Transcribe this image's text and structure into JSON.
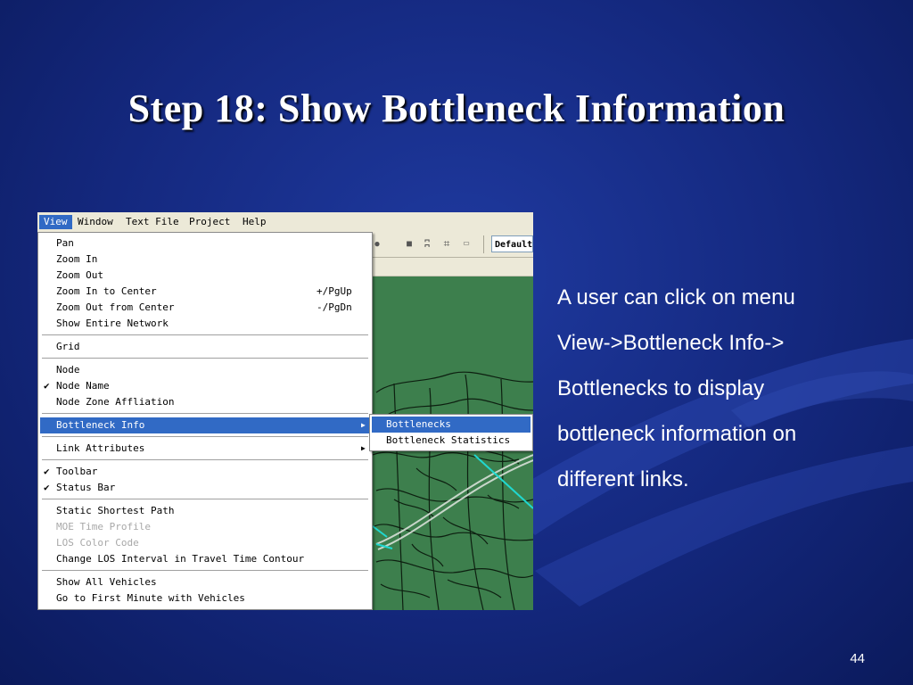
{
  "slide": {
    "title": "Step 18: Show Bottleneck Information",
    "body_lines": [
      "A user can click on menu",
      "View->Bottleneck Info->",
      "Bottlenecks to display",
      "bottleneck information on",
      "different links."
    ],
    "page_number": "44"
  },
  "app": {
    "menubar": [
      "View",
      "Window",
      "Text File",
      "Project",
      "Help"
    ],
    "toolbar": {
      "combo_value": "Default"
    },
    "view_menu": {
      "items": [
        {
          "label": "Pan",
          "shortcut": "",
          "checked": false,
          "disabled": false,
          "submenu": false
        },
        {
          "label": "Zoom In",
          "shortcut": "",
          "checked": false,
          "disabled": false,
          "submenu": false
        },
        {
          "label": "Zoom Out",
          "shortcut": "",
          "checked": false,
          "disabled": false,
          "submenu": false
        },
        {
          "label": "Zoom In to Center",
          "shortcut": "+/PgUp",
          "checked": false,
          "disabled": false,
          "submenu": false
        },
        {
          "label": "Zoom Out from Center",
          "shortcut": "-/PgDn",
          "checked": false,
          "disabled": false,
          "submenu": false
        },
        {
          "label": "Show Entire Network",
          "shortcut": "",
          "checked": false,
          "disabled": false,
          "submenu": false
        },
        {
          "label": "Grid",
          "shortcut": "",
          "checked": false,
          "disabled": false,
          "submenu": false
        },
        {
          "label": "Node",
          "shortcut": "",
          "checked": false,
          "disabled": false,
          "submenu": false
        },
        {
          "label": "Node Name",
          "shortcut": "",
          "checked": true,
          "disabled": false,
          "submenu": false
        },
        {
          "label": "Node Zone Affliation",
          "shortcut": "",
          "checked": false,
          "disabled": false,
          "submenu": false
        },
        {
          "label": "Bottleneck Info",
          "shortcut": "",
          "checked": false,
          "disabled": false,
          "submenu": true,
          "highlighted": true
        },
        {
          "label": "Link Attributes",
          "shortcut": "",
          "checked": false,
          "disabled": false,
          "submenu": true
        },
        {
          "label": "Toolbar",
          "shortcut": "",
          "checked": true,
          "disabled": false,
          "submenu": false
        },
        {
          "label": "Status Bar",
          "shortcut": "",
          "checked": true,
          "disabled": false,
          "submenu": false
        },
        {
          "label": "Static Shortest Path",
          "shortcut": "",
          "checked": false,
          "disabled": false,
          "submenu": false
        },
        {
          "label": "MOE Time Profile",
          "shortcut": "",
          "checked": false,
          "disabled": true,
          "submenu": false
        },
        {
          "label": "LOS Color Code",
          "shortcut": "",
          "checked": false,
          "disabled": true,
          "submenu": false
        },
        {
          "label": "Change LOS Interval in Travel Time Contour",
          "shortcut": "",
          "checked": false,
          "disabled": false,
          "submenu": false
        },
        {
          "label": "Show All Vehicles",
          "shortcut": "",
          "checked": false,
          "disabled": false,
          "submenu": false
        },
        {
          "label": "Go to First Minute with Vehicles",
          "shortcut": "",
          "checked": false,
          "disabled": false,
          "submenu": false
        }
      ],
      "check_glyph": "✔",
      "arrow_glyph": "▶"
    },
    "bottleneck_submenu": {
      "items": [
        "Bottlenecks",
        "Bottleneck Statistics"
      ]
    }
  }
}
